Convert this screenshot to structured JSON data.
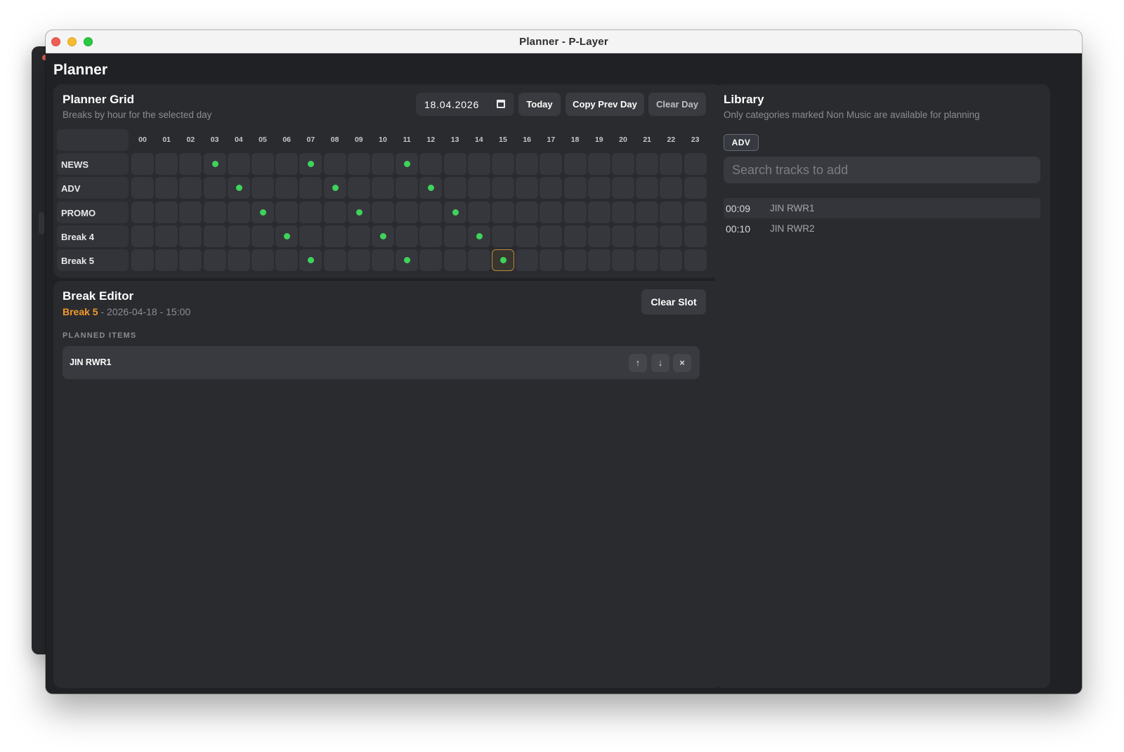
{
  "window": {
    "title": "Planner - P-Layer",
    "page_title": "Planner"
  },
  "grid": {
    "title": "Planner Grid",
    "subtitle": "Breaks by hour for the selected day",
    "date_value": "18.04.2026",
    "buttons": {
      "today": "Today",
      "copy_prev": "Copy Prev Day",
      "clear_day": "Clear Day"
    },
    "hours": [
      "00",
      "01",
      "02",
      "03",
      "04",
      "05",
      "06",
      "07",
      "08",
      "09",
      "10",
      "11",
      "12",
      "13",
      "14",
      "15",
      "16",
      "17",
      "18",
      "19",
      "20",
      "21",
      "22",
      "23"
    ],
    "rows": [
      {
        "label": "NEWS",
        "filled": [
          3,
          7,
          11
        ]
      },
      {
        "label": "ADV",
        "filled": [
          4,
          8,
          12
        ]
      },
      {
        "label": "PROMO",
        "filled": [
          5,
          9,
          13
        ]
      },
      {
        "label": "Break 4",
        "filled": [
          6,
          10,
          14
        ]
      },
      {
        "label": "Break 5",
        "filled": [
          7,
          11,
          15
        ]
      }
    ],
    "selected": {
      "row": 4,
      "hour": 15
    },
    "colors": {
      "filled_dot": "#3ed45b",
      "selected_border": "#b98a3e"
    }
  },
  "editor": {
    "title": "Break Editor",
    "break_name": "Break 5",
    "sep1": " - ",
    "date": "2026-04-18",
    "sep2": " - ",
    "time": "15:00",
    "clear_slot": "Clear Slot",
    "section_label": "PLANNED ITEMS",
    "items": [
      {
        "name": "JIN RWR1"
      }
    ],
    "icons": [
      "arrow-up-icon",
      "arrow-down-icon",
      "close-icon"
    ],
    "accent_color": "#f39a2b"
  },
  "library": {
    "title": "Library",
    "subtitle": "Only categories marked Non Music are available for planning",
    "category_chip": "ADV",
    "search_placeholder": "Search tracks to add",
    "tracks": [
      {
        "duration": "00:09",
        "name": "JIN RWR1"
      },
      {
        "duration": "00:10",
        "name": "JIN RWR2"
      }
    ]
  }
}
